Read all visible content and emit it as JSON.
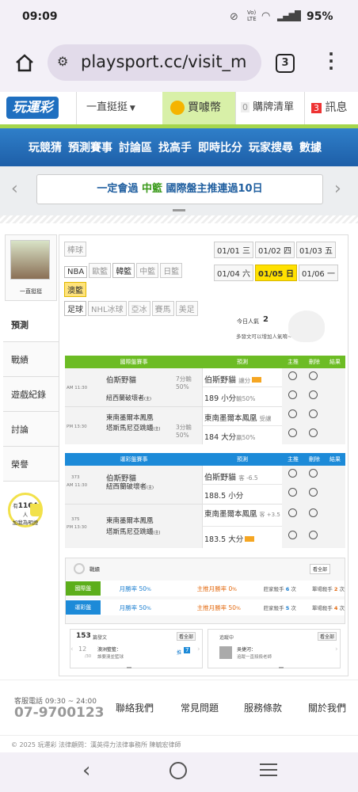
{
  "status": {
    "time": "09:09",
    "battery": "95%",
    "net_label": "Vo) LTE"
  },
  "browser": {
    "url": "playsport.cc/visit_m",
    "tabs": "3"
  },
  "site": {
    "logo": "玩運彩",
    "dropdown": "一直挺挺",
    "buy": "買噱幣",
    "watch_count": "0",
    "watch": "購牌清單",
    "msg_count": "3",
    "msg": "訊息"
  },
  "nav": [
    "玩競猜",
    "預測賽事",
    "討論區",
    "找高手",
    "即時比分",
    "玩家搜尋",
    "數據"
  ],
  "banner": {
    "text_a": "一定會過 ",
    "text_b": "中籃 ",
    "text_c": "國際盤主推連過10日"
  },
  "user": {
    "name": "一直挺挺"
  },
  "sidebar": {
    "items": [
      "預測",
      "戰績",
      "遊戲紀錄",
      "討論",
      "榮譽"
    ],
    "fans_prefix": "有",
    "fans": "1164",
    "fans_suffix": "人",
    "fans_line2": "加我為明燈"
  },
  "leagues": {
    "row1": [
      "棒球"
    ],
    "row2": [
      "NBA",
      "歐籃",
      "韓籃",
      "中籃",
      "日籃"
    ],
    "row3": [
      "澳籃"
    ],
    "row4": [
      "足球",
      "NHL冰球",
      "亞冰",
      "賽馬",
      "美足"
    ]
  },
  "dates": [
    "01/01 三",
    "01/02 四",
    "01/03 五",
    "01/04 六",
    "01/05 日",
    "01/06 一"
  ],
  "today": {
    "label": "今日人氣",
    "count": "2",
    "hint": "多發文可以增加人氣唷~"
  },
  "intl": {
    "header": "國際盤賽事",
    "pred": "預測",
    "main": "主推",
    "del": "刪除",
    "result": "結果",
    "games": [
      {
        "time": "AM 11:30",
        "away": "伯斯野貓",
        "home": "紐西蘭破壞者",
        "home_sub": "(主)",
        "fav": "7分輸",
        "fav2": "50%",
        "pick1": "伯斯野貓",
        "pick1_sub": "讓分",
        "pick2": "189 小分",
        "pick2_sub": "輸50%"
      },
      {
        "time": "PM 13:30",
        "away": "東南墨爾本鳳凰",
        "home": "塔斯馬尼亞跳蟻",
        "home_sub": "(主)",
        "fav": "3分輸",
        "fav2": "50%",
        "pick1": "東南墨爾本鳳凰",
        "pick1_sub": "受讓",
        "pick2": "184 大分",
        "pick2_sub": "贏50%"
      }
    ]
  },
  "tw": {
    "header": "運彩盤賽事",
    "games": [
      {
        "no": "373",
        "time": "AM 11:30",
        "away": "伯斯野貓",
        "home": "紐西蘭破壞者",
        "home_sub": "(主)",
        "pick1": "伯斯野貓",
        "pick1_sub": "客 -6.5",
        "pick2": "188.5 小分"
      },
      {
        "no": "375",
        "time": "PM 13:30",
        "away": "東南墨爾本鳳凰",
        "home": "塔斯馬尼亞跳蟻",
        "home_sub": "(主)",
        "pick1": "東南墨爾本鳳凰",
        "pick1_sub": "客 +3.5",
        "pick2": "183.5 大分"
      }
    ]
  },
  "record": {
    "title": "戰績",
    "all": "看全部",
    "rows": [
      {
        "name": "國際盤",
        "m": "月勝率",
        "mv": "50",
        "ms": "%",
        "mp": "主推月勝率",
        "mpv": "0",
        "mps": "%",
        "streak": "莊家殺手",
        "sv": "6",
        "su": "次",
        "single": "單場殺手",
        "sgv": "2",
        "sgu": "次"
      },
      {
        "name": "運彩盤",
        "m": "月勝率",
        "mv": "50",
        "ms": "%",
        "mp": "主推月勝率",
        "mpv": "50",
        "mps": "%",
        "streak": "莊家殺手",
        "sv": "5",
        "su": "次",
        "single": "單場殺手",
        "sgv": "4",
        "sgu": "次"
      }
    ]
  },
  "posts": {
    "count": "153",
    "label": "篇發文",
    "all": "看全部",
    "day": "12",
    "month": "/30",
    "board": "澳洲籃籃：",
    "snippet": "誰要澳並籃球",
    "badge_text": "推",
    "badge": "7"
  },
  "follows": {
    "label": "追蹤中",
    "all": "看全部",
    "name": "吳捷河：",
    "desc": "追蹤一直殺殺老師"
  },
  "footer": {
    "hours": "客服電話 09:30 ~ 24:00",
    "phone": "07-9700123",
    "links": [
      "聯絡我們",
      "常見問題",
      "服務條款",
      "關於我們"
    ],
    "copy": "© 2025 玩運彩  法律顧問：漢英得力法律事務所 陳毓宏律師"
  }
}
